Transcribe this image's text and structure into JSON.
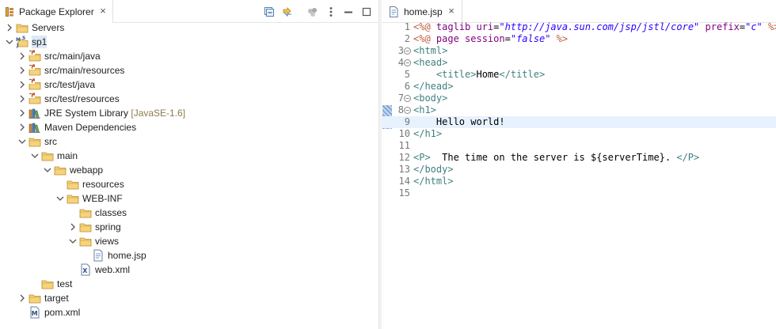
{
  "explorer": {
    "tab_label": "Package Explorer",
    "tab_close": "×",
    "toolbar": [
      "collapse-all",
      "link-with-editor",
      "focus-on-active",
      "view-menu",
      "minimize",
      "maximize"
    ]
  },
  "tree": [
    {
      "label": "Servers",
      "icon": "folder-icon",
      "twisty": "collapsed",
      "level": 0
    },
    {
      "label": "sp1",
      "icon": "maven-project-icon",
      "twisty": "expanded",
      "level": 0,
      "selected": true
    },
    {
      "label": "src/main/java",
      "icon": "source-folder-icon",
      "twisty": "collapsed",
      "level": 1
    },
    {
      "label": "src/main/resources",
      "icon": "source-folder-icon",
      "twisty": "collapsed",
      "level": 1
    },
    {
      "label": "src/test/java",
      "icon": "source-folder-icon",
      "twisty": "collapsed",
      "level": 1
    },
    {
      "label": "src/test/resources",
      "icon": "source-folder-icon",
      "twisty": "collapsed",
      "level": 1
    },
    {
      "label": "JRE System Library",
      "decoration": "[JavaSE-1.6]",
      "icon": "library-icon",
      "twisty": "collapsed",
      "level": 1
    },
    {
      "label": "Maven Dependencies",
      "icon": "library-icon",
      "twisty": "collapsed",
      "level": 1
    },
    {
      "label": "src",
      "icon": "folder-icon",
      "twisty": "expanded",
      "level": 1
    },
    {
      "label": "main",
      "icon": "folder-icon",
      "twisty": "expanded",
      "level": 2
    },
    {
      "label": "webapp",
      "icon": "folder-icon",
      "twisty": "expanded",
      "level": 3
    },
    {
      "label": "resources",
      "icon": "folder-icon",
      "twisty": "none",
      "level": 4
    },
    {
      "label": "WEB-INF",
      "icon": "folder-icon",
      "twisty": "expanded",
      "level": 4
    },
    {
      "label": "classes",
      "icon": "folder-icon",
      "twisty": "none",
      "level": 5
    },
    {
      "label": "spring",
      "icon": "folder-icon",
      "twisty": "collapsed",
      "level": 5
    },
    {
      "label": "views",
      "icon": "folder-icon",
      "twisty": "expanded",
      "level": 5
    },
    {
      "label": "home.jsp",
      "icon": "jsp-file-icon",
      "twisty": "none",
      "level": 6
    },
    {
      "label": "web.xml",
      "icon": "xml-file-icon",
      "twisty": "none",
      "level": 5
    },
    {
      "label": "test",
      "icon": "folder-icon",
      "twisty": "none",
      "level": 2
    },
    {
      "label": "target",
      "icon": "folder-icon",
      "twisty": "collapsed",
      "level": 1
    },
    {
      "label": "pom.xml",
      "icon": "maven-pom-icon",
      "twisty": "none",
      "level": 1
    }
  ],
  "editor": {
    "tab_label": "home.jsp",
    "tab_close": "×",
    "current_line": 9,
    "lines": [
      {
        "n": "1",
        "fold": "",
        "parts": [
          [
            "c-dir",
            "<%@ "
          ],
          [
            "c-attr",
            "taglib "
          ],
          [
            "c-attr",
            "uri"
          ],
          [
            "c-text",
            "="
          ],
          [
            "c-val",
            "\"http://java.sun.com/jsp/jstl/core\""
          ],
          [
            "c-text",
            " "
          ],
          [
            "c-attr",
            "prefix"
          ],
          [
            "c-text",
            "="
          ],
          [
            "c-val",
            "\"c\""
          ],
          [
            "c-dir",
            " %>"
          ]
        ]
      },
      {
        "n": "2",
        "fold": "",
        "parts": [
          [
            "c-dir",
            "<%@ "
          ],
          [
            "c-attr",
            "page "
          ],
          [
            "c-attr",
            "session"
          ],
          [
            "c-text",
            "="
          ],
          [
            "c-val",
            "\"false\""
          ],
          [
            "c-dir",
            " %>"
          ]
        ]
      },
      {
        "n": "3",
        "fold": "⊖",
        "parts": [
          [
            "c-tag",
            "<html>"
          ]
        ]
      },
      {
        "n": "4",
        "fold": "⊖",
        "parts": [
          [
            "c-tag",
            "<head>"
          ]
        ]
      },
      {
        "n": "5",
        "fold": "",
        "parts": [
          [
            "c-text",
            "    "
          ],
          [
            "c-tag",
            "<title>"
          ],
          [
            "c-text",
            "Home"
          ],
          [
            "c-tag",
            "</title>"
          ]
        ]
      },
      {
        "n": "6",
        "fold": "",
        "parts": [
          [
            "c-tag",
            "</head>"
          ]
        ]
      },
      {
        "n": "7",
        "fold": "⊖",
        "parts": [
          [
            "c-tag",
            "<body>"
          ]
        ]
      },
      {
        "n": "8",
        "fold": "⊖",
        "parts": [
          [
            "c-tag",
            "<h1>"
          ]
        ]
      },
      {
        "n": "9",
        "fold": "",
        "parts": [
          [
            "c-text",
            "    Hello world!"
          ]
        ]
      },
      {
        "n": "10",
        "fold": "",
        "parts": [
          [
            "c-tag",
            "</h1>"
          ]
        ]
      },
      {
        "n": "11",
        "fold": "",
        "parts": []
      },
      {
        "n": "12",
        "fold": "",
        "parts": [
          [
            "c-tag",
            "<P>"
          ],
          [
            "c-text",
            "  The time on the server is ${serverTime}. "
          ],
          [
            "c-tag",
            "</P>"
          ]
        ]
      },
      {
        "n": "13",
        "fold": "",
        "parts": [
          [
            "c-tag",
            "</body>"
          ]
        ]
      },
      {
        "n": "14",
        "fold": "",
        "parts": [
          [
            "c-tag",
            "</html>"
          ]
        ]
      },
      {
        "n": "15",
        "fold": "",
        "parts": []
      }
    ]
  }
}
